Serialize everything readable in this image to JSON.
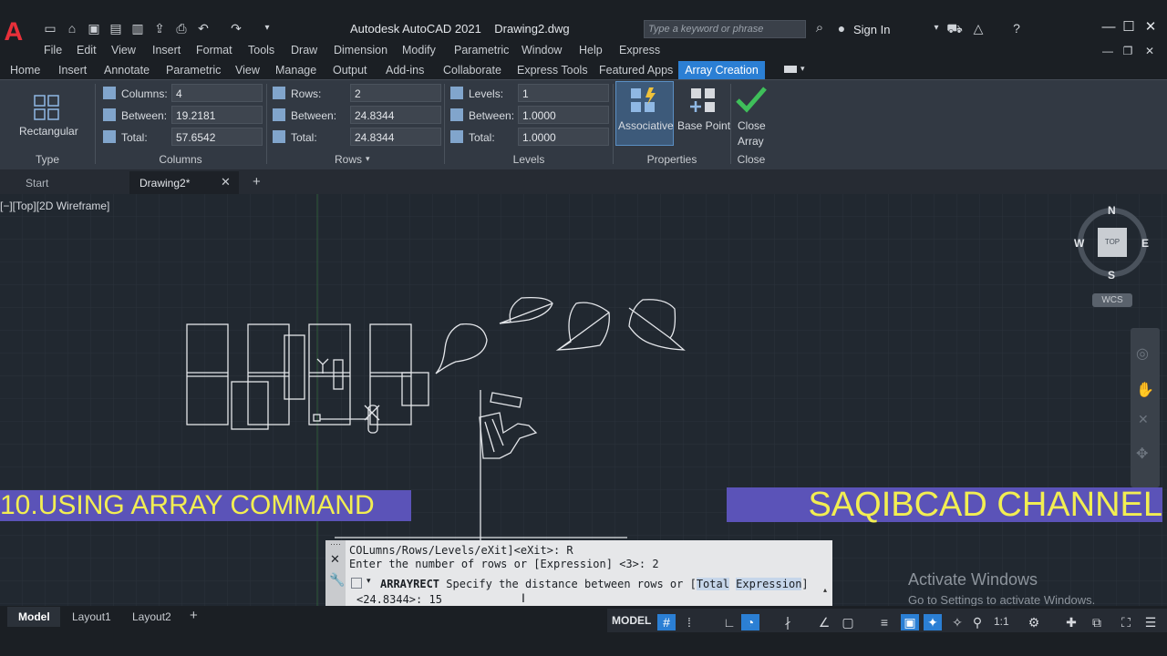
{
  "title": {
    "app_name": "Autodesk AutoCAD 2021",
    "file_name": "Drawing2.dwg",
    "search_placeholder": "Type a keyword or phrase",
    "sign_in": "Sign In"
  },
  "menubar": [
    "File",
    "Edit",
    "View",
    "Insert",
    "Format",
    "Tools",
    "Draw",
    "Dimension",
    "Modify",
    "Parametric",
    "Window",
    "Help",
    "Express"
  ],
  "ribbon_tabs": [
    "Home",
    "Insert",
    "Annotate",
    "Parametric",
    "View",
    "Manage",
    "Output",
    "Add-ins",
    "Collaborate",
    "Express Tools",
    "Featured Apps"
  ],
  "active_ribbon_tab": "Array Creation",
  "ribbon": {
    "type": {
      "button": "Rectangular",
      "title": "Type"
    },
    "columns": {
      "title": "Columns",
      "columns_label": "Columns:",
      "columns_value": "4",
      "between_label": "Between:",
      "between_value": "19.2181",
      "total_label": "Total:",
      "total_value": "57.6542"
    },
    "rows": {
      "title": "Rows",
      "rows_label": "Rows:",
      "rows_value": "2",
      "between_label": "Between:",
      "between_value": "24.8344",
      "total_label": "Total:",
      "total_value": "24.8344"
    },
    "levels": {
      "title": "Levels",
      "levels_label": "Levels:",
      "levels_value": "1",
      "between_label": "Between:",
      "between_value": "1.0000",
      "total_label": "Total:",
      "total_value": "1.0000"
    },
    "properties": {
      "associative": "Associative",
      "base_point": "Base Point",
      "title": "Properties"
    },
    "close": {
      "close_line1": "Close",
      "close_line2": "Array",
      "title": "Close"
    }
  },
  "doc_tabs": {
    "start": "Start",
    "drawing": "Drawing2*"
  },
  "viewport_label": "[−][Top][2D Wireframe]",
  "viewcube": {
    "n": "N",
    "s": "S",
    "e": "E",
    "w": "W",
    "face": "TOP",
    "wcs": "WCS"
  },
  "overlays": {
    "left": "10.USING ARRAY COMMAND",
    "right": "SAQIBCAD CHANNEL"
  },
  "command_line": {
    "history1": "COLumns/Rows/Levels/eXit]<eXit>: R",
    "history2": "Enter the number of rows or [Expression] <3>: 2",
    "command": "ARRAYRECT",
    "prompt_text": "Specify the distance between rows or [",
    "option1": "Total",
    "option2": "Expression",
    "prompt_end": "]",
    "input_prefix": "<24.8344>: ",
    "input_value": "15"
  },
  "watermark": {
    "line1": "Activate Windows",
    "line2": "Go to Settings to activate Windows."
  },
  "status": {
    "layout_tabs": [
      "Model",
      "Layout1",
      "Layout2"
    ],
    "model_label": "MODEL",
    "scale": "1:1"
  },
  "colors": {
    "accent": "#2b7fd4",
    "overlay_bg": "#5b53b8",
    "overlay_text": "#f2ee52",
    "autocad_red": "#e8303a"
  }
}
